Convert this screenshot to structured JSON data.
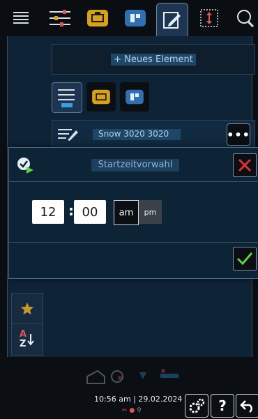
{
  "toolbar": {
    "tools": [
      {
        "name": "list-icon"
      },
      {
        "name": "settings-sliders-icon"
      },
      {
        "name": "cooking-pot-icon",
        "color": "#d6a21b"
      },
      {
        "name": "cabinet-icon",
        "color": "#2f6fb2"
      },
      {
        "name": "edit-icon",
        "active": true
      },
      {
        "name": "vertical-resize-icon"
      },
      {
        "name": "search-icon"
      }
    ]
  },
  "background": {
    "new_element_label": "+ Neues Element",
    "row_label": "Snow 3020 3020"
  },
  "dialog": {
    "title": "Startzeitvorwahl",
    "hours": "12",
    "separator": ":",
    "minutes": "00",
    "am_label": "am",
    "pm_label": "pm",
    "selected_period": "am"
  },
  "sidebar": {
    "favorites_icon": "star-icon",
    "sort_icon": "sort-az-icon",
    "sort_a": "A",
    "sort_z": "Z"
  },
  "footer": {
    "time": "10:56 am",
    "separator": "|",
    "date": "29.02.2024",
    "help_label": "?"
  },
  "colors": {
    "accent_red": "#e03030",
    "accent_green": "#5fcf4a",
    "active_tab": "#1d3550"
  }
}
